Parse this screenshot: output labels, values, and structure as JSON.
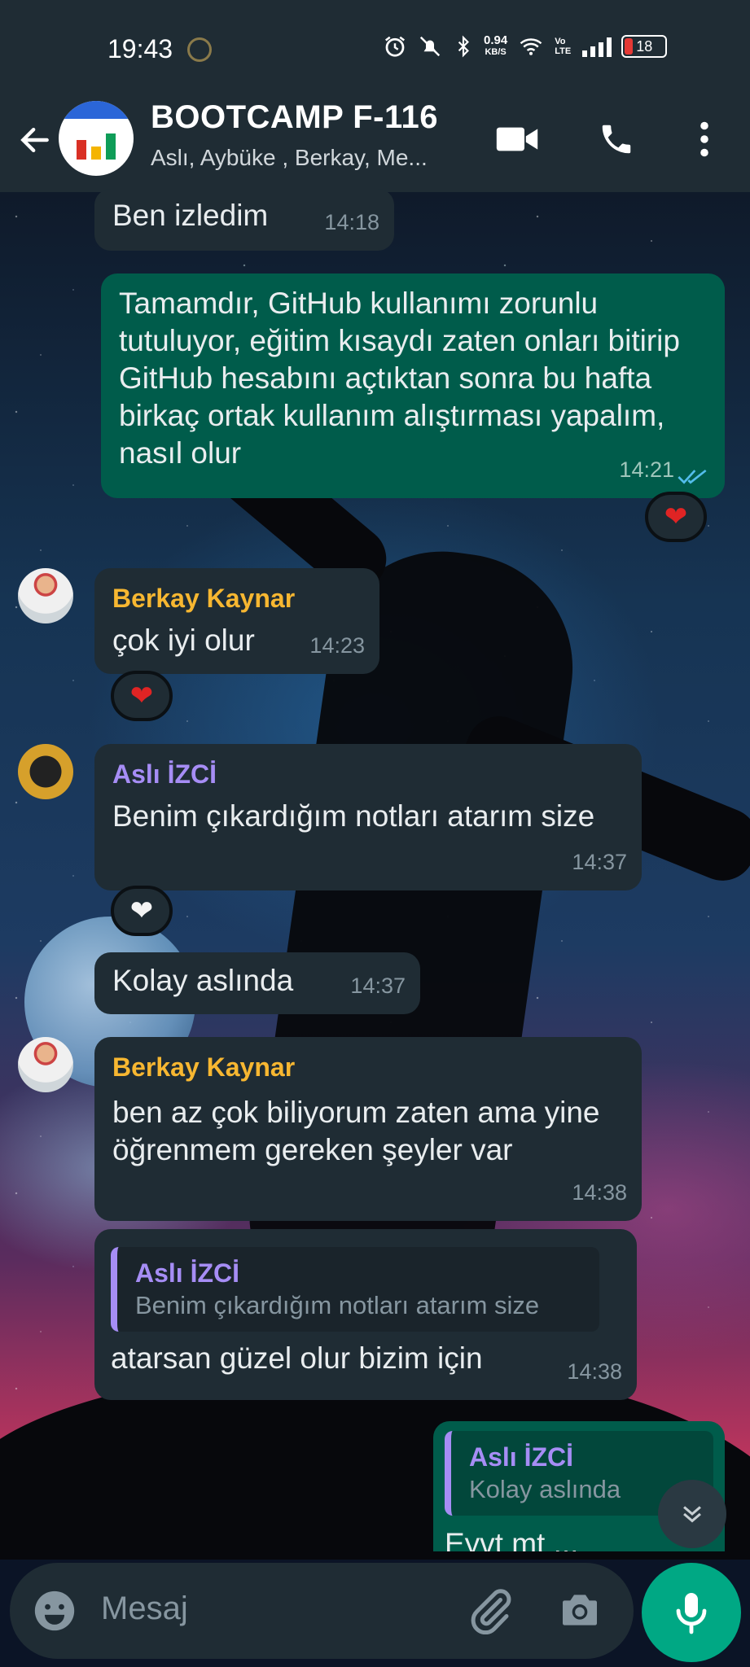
{
  "status": {
    "time": "19:43",
    "net_speed_value": "0.94",
    "net_speed_unit": "KB/S",
    "volte": "Vo LTE",
    "battery": "18"
  },
  "header": {
    "title": "BOOTCAMP F-116",
    "subtitle": "Aslı, Aybüke , Berkay, Me..."
  },
  "messages": [
    {
      "text": "Ben izledim",
      "time": "14:18"
    },
    {
      "text": "Tamamdır, GitHub kullanımı zorunlu tutuluyor, eğitim kısaydı zaten onları bitirip GitHub hesabını açtıktan sonra bu hafta birkaç ortak kullanım alıştırması yapalım, nasıl olur",
      "time": "14:21",
      "reaction": "❤"
    },
    {
      "sender": "Berkay Kaynar",
      "text": "çok iyi olur",
      "time": "14:23",
      "reaction": "❤"
    },
    {
      "sender": "Aslı İZCİ",
      "text": "Benim çıkardığım notları atarım size",
      "time": "14:37",
      "reaction": "❤"
    },
    {
      "text": "Kolay aslında",
      "time": "14:37"
    },
    {
      "sender": "Berkay Kaynar",
      "text": "ben az çok biliyorum zaten ama yine öğrenmem gereken şeyler var",
      "time": "14:38"
    },
    {
      "quote_name": "Aslı İZCİ",
      "quote_text": "Benim çıkardığım notları atarım size",
      "text": "atarsan güzel olur bizim için",
      "time": "14:38"
    },
    {
      "quote_name": "Aslı İZCİ",
      "quote_text": "Kolay aslında",
      "text": "Eyvt mt ..."
    }
  ],
  "input": {
    "placeholder": "Mesaj"
  },
  "colors": {
    "header_bg": "#1f2c34",
    "incoming_bubble": "#1f2c34",
    "outgoing_bubble": "#005c4b",
    "sender_orange": "#f7b731",
    "sender_purple": "#a68df5",
    "mic_green": "#00a884"
  }
}
